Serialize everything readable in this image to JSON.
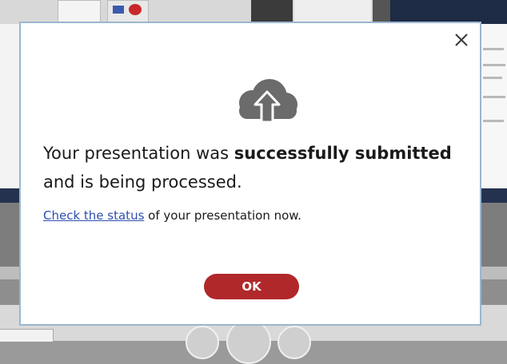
{
  "dialog": {
    "message_part1": "Your presentation was ",
    "message_bold": "successfully submitted",
    "message_part2": " and is being processed.",
    "status_link": "Check the status",
    "status_rest": " of your presentation now.",
    "ok_label": "OK",
    "icon": "cloud-upload-icon",
    "close_icon": "close-icon"
  },
  "colors": {
    "accent_red": "#b0282a",
    "link_blue": "#2e4fb0",
    "icon_grey": "#6b6b6b",
    "dialog_border": "#9ab7cf"
  }
}
